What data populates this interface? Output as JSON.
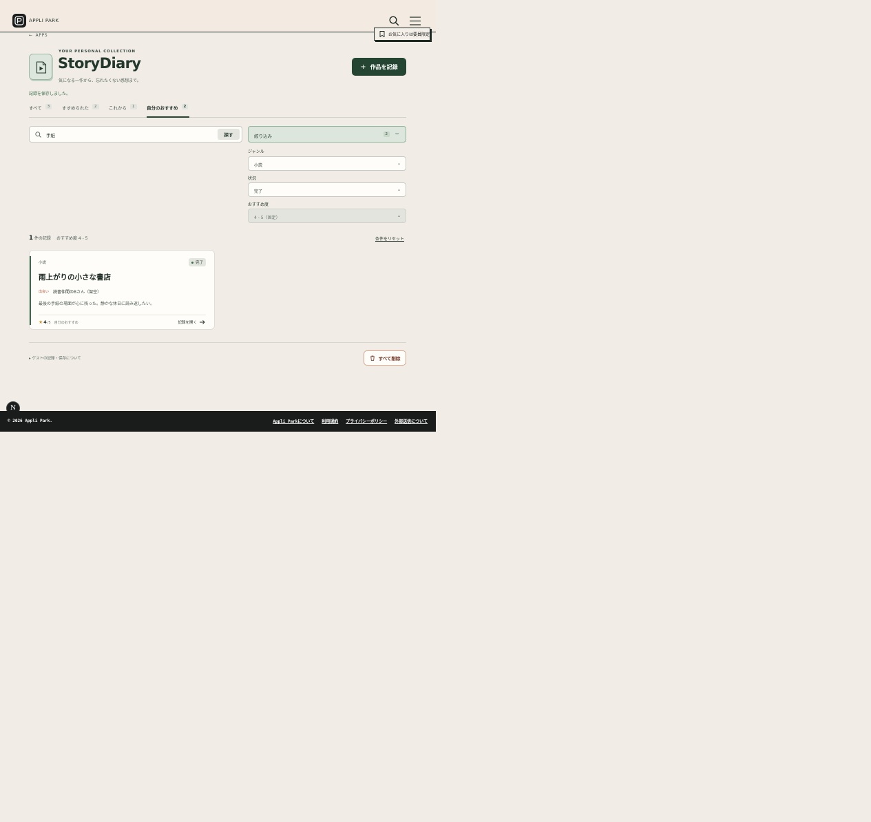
{
  "header": {
    "brand": "APPLI PARK"
  },
  "favorite_label": "お気に入りは要員限定",
  "back_label": "APPS",
  "app": {
    "eyebrow": "YOUR PERSONAL COLLECTION",
    "title": "StoryDiary",
    "tagline": "気になる一作から、忘れたくない感想まで。",
    "add_label": "作品を記録"
  },
  "saved_message": "記録を保存しました。",
  "tabs": [
    {
      "label": "すべて",
      "count": "3"
    },
    {
      "label": "すすめられた",
      "count": "2"
    },
    {
      "label": "これから",
      "count": "1"
    },
    {
      "label": "自分のおすすめ",
      "count": "2"
    }
  ],
  "search": {
    "value": "手紙",
    "button": "探す"
  },
  "filter": {
    "label": "絞り込み",
    "count": "2",
    "toggle": "−",
    "genre_label": "ジャンル",
    "genre_value": "小説",
    "status_label": "状況",
    "status_value": "完了",
    "rec_label": "おすすめ度",
    "rec_value": "4 - 5（固定）"
  },
  "results": {
    "count": "1",
    "suffix": "件の記録",
    "condition": "おすすめ度 4 - 5",
    "reset": "条件をリセット"
  },
  "card": {
    "genre": "小説",
    "status": "完了",
    "title": "雨上がりの小さな書店",
    "meta_key": "出会い",
    "meta_value": "読書仲間のBさん（架空）",
    "note": "最後の手紙の場面が心に残った。静かな休日に読み返したい。",
    "rating": "4",
    "rating_max": "/5",
    "tag": "自分のおすすめ",
    "open": "記録を開く"
  },
  "guest_info": "▸ ゲストの記録・保存について",
  "delete_all": "すべて削除",
  "badge": "N",
  "footer": {
    "copyright": "© 2026 Appli Park.",
    "links": [
      "Appli Parkについて",
      "利用規約",
      "プライバシーポリシー",
      "外部送信について"
    ]
  },
  "colors": {
    "accent": "#234532",
    "background": "#f1ede6",
    "footer": "#1a1c1b",
    "danger": "#6b2f1c"
  }
}
